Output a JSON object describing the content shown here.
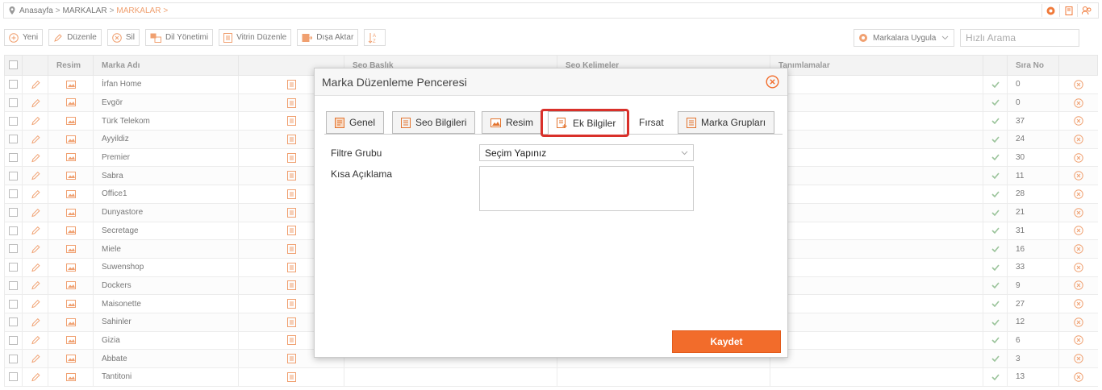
{
  "breadcrumb": [
    "Anasayfa",
    "MARKALAR",
    "MARKALAR"
  ],
  "breadcrumb_sep": ">",
  "toolbar": {
    "new_label": "Yeni",
    "edit_label": "Düzenle",
    "delete_label": "Sil",
    "language_label": "Dil Yönetimi",
    "showcase_label": "Vitrin Düzenle",
    "export_label": "Dışa Aktar",
    "apply_label": "Markalara Uygula",
    "search_placeholder": "Hızlı Arama"
  },
  "table": {
    "headers": [
      "",
      "",
      "Resim",
      "Marka Adı",
      "",
      "Seo Başlık",
      "Seo Kelimeler",
      "Tanımlamalar",
      "",
      "Sıra No",
      ""
    ],
    "rows": [
      {
        "name": "İrfan Home",
        "order": "0"
      },
      {
        "name": "Evgör",
        "order": "0"
      },
      {
        "name": "Türk Telekom",
        "order": "37"
      },
      {
        "name": "Ayyildiz",
        "order": "24"
      },
      {
        "name": "Premier",
        "order": "30"
      },
      {
        "name": "Sabra",
        "order": "11"
      },
      {
        "name": "Office1",
        "order": "28"
      },
      {
        "name": "Dunyastore",
        "order": "21"
      },
      {
        "name": "Secretage",
        "order": "31"
      },
      {
        "name": "Miele",
        "order": "16"
      },
      {
        "name": "Suwenshop",
        "order": "33"
      },
      {
        "name": "Dockers",
        "order": "9"
      },
      {
        "name": "Maisonette",
        "order": "27"
      },
      {
        "name": "Sahinler",
        "order": "12"
      },
      {
        "name": "Gizia",
        "order": "6"
      },
      {
        "name": "Abbate",
        "order": "3"
      },
      {
        "name": "Tantitoni",
        "order": "13"
      }
    ]
  },
  "modal": {
    "title": "Marka Düzenleme Penceresi",
    "tabs": [
      {
        "label": "Genel",
        "icon": "doc-icon"
      },
      {
        "label": "Seo Bilgileri",
        "icon": "list-icon"
      },
      {
        "label": "Resim",
        "icon": "image-icon"
      },
      {
        "label": "Ek Bilgiler",
        "icon": "doc-plus-icon"
      },
      {
        "label": "Fırsat",
        "icon": ""
      },
      {
        "label": "Marka Grupları",
        "icon": "list-icon"
      }
    ],
    "active_tab": "Ek Bilgiler",
    "filter_group_label": "Filtre Grubu",
    "filter_group_value": "Seçim Yapınız",
    "short_desc_label": "Kısa Açıklama",
    "short_desc_value": "",
    "save_label": "Kaydet"
  },
  "colors": {
    "accent": "#f26c2b",
    "icon_orange": "#f0a070",
    "highlight": "#d9302a",
    "check_green": "#9bc49b"
  }
}
